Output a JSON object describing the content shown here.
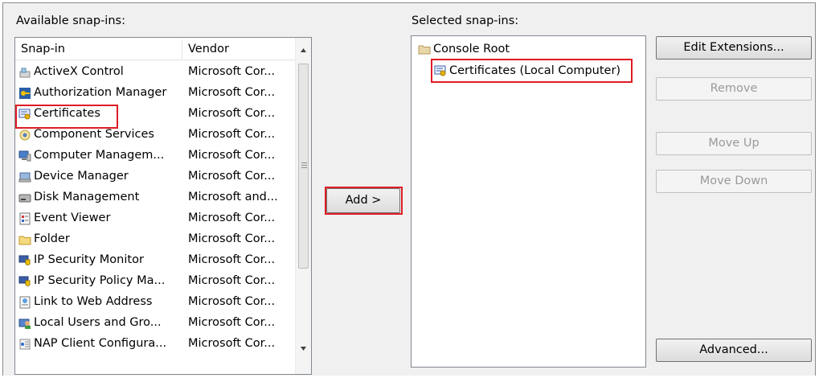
{
  "available_label": "Available snap-ins:",
  "selected_label": "Selected snap-ins:",
  "columns": {
    "snapin": "Snap-in",
    "vendor": "Vendor"
  },
  "snapins": [
    {
      "name": "ActiveX Control",
      "vendor": "Microsoft Cor...",
      "icon": "activex-icon"
    },
    {
      "name": "Authorization Manager",
      "vendor": "Microsoft Cor...",
      "icon": "authorization-manager-icon"
    },
    {
      "name": "Certificates",
      "vendor": "Microsoft Cor...",
      "icon": "certificate-icon"
    },
    {
      "name": "Component Services",
      "vendor": "Microsoft Cor...",
      "icon": "component-services-icon"
    },
    {
      "name": "Computer Managem...",
      "vendor": "Microsoft Cor...",
      "icon": "computer-management-icon"
    },
    {
      "name": "Device Manager",
      "vendor": "Microsoft Cor...",
      "icon": "device-manager-icon"
    },
    {
      "name": "Disk Management",
      "vendor": "Microsoft and...",
      "icon": "disk-management-icon"
    },
    {
      "name": "Event Viewer",
      "vendor": "Microsoft Cor...",
      "icon": "event-viewer-icon"
    },
    {
      "name": "Folder",
      "vendor": "Microsoft Cor...",
      "icon": "folder-icon"
    },
    {
      "name": "IP Security Monitor",
      "vendor": "Microsoft Cor...",
      "icon": "ip-security-icon"
    },
    {
      "name": "IP Security Policy Ma...",
      "vendor": "Microsoft Cor...",
      "icon": "ip-security-icon"
    },
    {
      "name": "Link to Web Address",
      "vendor": "Microsoft Cor...",
      "icon": "web-link-icon"
    },
    {
      "name": "Local Users and Gro...",
      "vendor": "Microsoft Cor...",
      "icon": "local-users-icon"
    },
    {
      "name": "NAP Client Configura...",
      "vendor": "Microsoft Cor...",
      "icon": "nap-client-icon"
    }
  ],
  "buttons": {
    "add": "Add >",
    "edit_extensions": "Edit Extensions...",
    "remove": "Remove",
    "move_up": "Move Up",
    "move_down": "Move Down",
    "advanced": "Advanced..."
  },
  "tree": {
    "root": "Console Root",
    "child": "Certificates (Local Computer)"
  },
  "highlight_color": "#e01b24"
}
